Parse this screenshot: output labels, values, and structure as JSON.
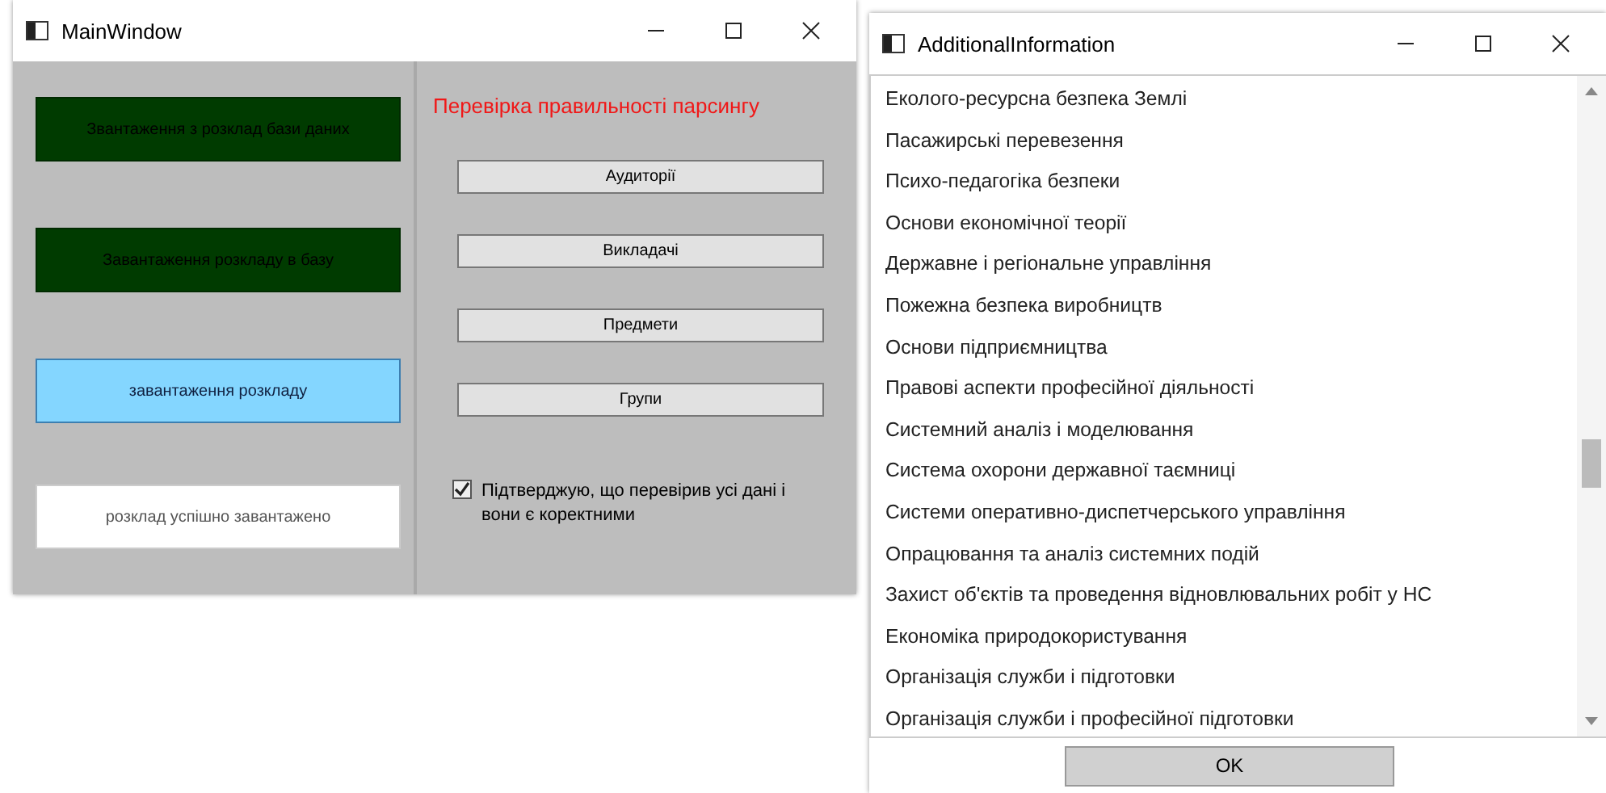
{
  "main_window": {
    "title": "MainWindow",
    "left_buttons": [
      {
        "kind": "dark",
        "label": "Звантаження з розклад бази даних"
      },
      {
        "kind": "dark",
        "label": "Завантаження розкладу в базу"
      },
      {
        "kind": "light",
        "label": "завантаження розкладу"
      }
    ],
    "status_field": {
      "value": "розклад успішно завантажено"
    },
    "check_title": "Перевірка правильності парсингу",
    "check_buttons": [
      "Аудиторії",
      "Викладачі",
      "Предмети",
      "Групи"
    ],
    "confirm": {
      "label": "Підтверджую, що перевірив усі дані і вони є коректними",
      "checked": true
    }
  },
  "info_window": {
    "title": "AdditionalInformation",
    "items": [
      "Еколого-ресурсна безпека Землі",
      "Пасажирські перевезення",
      "Психо-педагогіка безпеки",
      "Основи економічної теорії",
      "Державне і регіональне управління",
      "Пожежна безпека виробництв",
      "Основи підприємництва",
      "Правові аспекти професійної діяльності",
      "Системний аналіз і моделювання",
      "Система охорони державної таємниці",
      "Системи оперативно-диспетчерського управління",
      "Опрацювання та аналіз системних подій",
      "Захист об'єктів та проведення відновлювальних робіт у НС",
      "Економіка природокористування",
      "Організація служби і підготовки",
      "Організація служби і професійної підготовки"
    ],
    "ok": "OK"
  }
}
